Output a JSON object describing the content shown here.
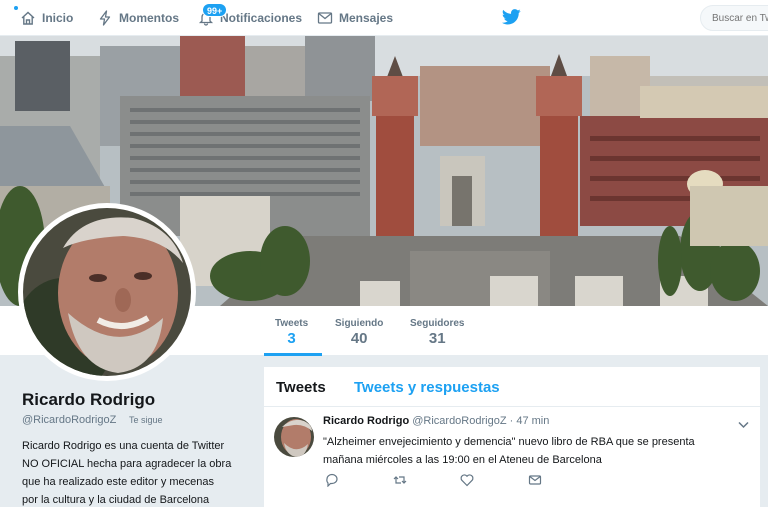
{
  "nav": {
    "home": "Inicio",
    "moments": "Momentos",
    "notifications": "Notificaciones",
    "notifications_badge": "99+",
    "messages": "Mensajes",
    "search_placeholder": "Buscar en Twitter"
  },
  "profile_nav": [
    {
      "label": "Tweets",
      "value": "3",
      "active": true
    },
    {
      "label": "Siguiendo",
      "value": "40",
      "active": false
    },
    {
      "label": "Seguidores",
      "value": "31",
      "active": false
    }
  ],
  "profile": {
    "name": "Ricardo Rodrigo",
    "handle": "@RicardoRodrigoZ",
    "follows_you": "Te sigue",
    "bio_lines": [
      "Ricardo Rodrigo es una cuenta de Twitter",
      "NO OFICIAL hecha para agradecer la obra",
      "que ha realizado este editor y mecenas",
      "por la cultura y la ciudad de Barcelona"
    ]
  },
  "timeline": {
    "tabs": [
      "Tweets",
      "Tweets y respuestas"
    ],
    "tweet": {
      "name": "Ricardo Rodrigo",
      "handle": "@RicardoRodrigoZ",
      "separator": "·",
      "time": "47 min",
      "text_lines": [
        "\"Alzheimer envejecimiento y demencia\" nuevo libro de RBA que se presenta",
        "mañana miércoles a las 19:00 en el Ateneu de Barcelona"
      ]
    }
  },
  "icons": [
    "home-icon",
    "lightning-icon",
    "bell-icon",
    "envelope-icon",
    "twitter-bird-icon",
    "chevron-down-icon",
    "reply-icon",
    "retweet-icon",
    "like-icon",
    "direct-message-icon"
  ],
  "colors": {
    "accent": "#1da1f2",
    "muted": "#657786",
    "text": "#14171a",
    "background": "#e6ecf0"
  }
}
